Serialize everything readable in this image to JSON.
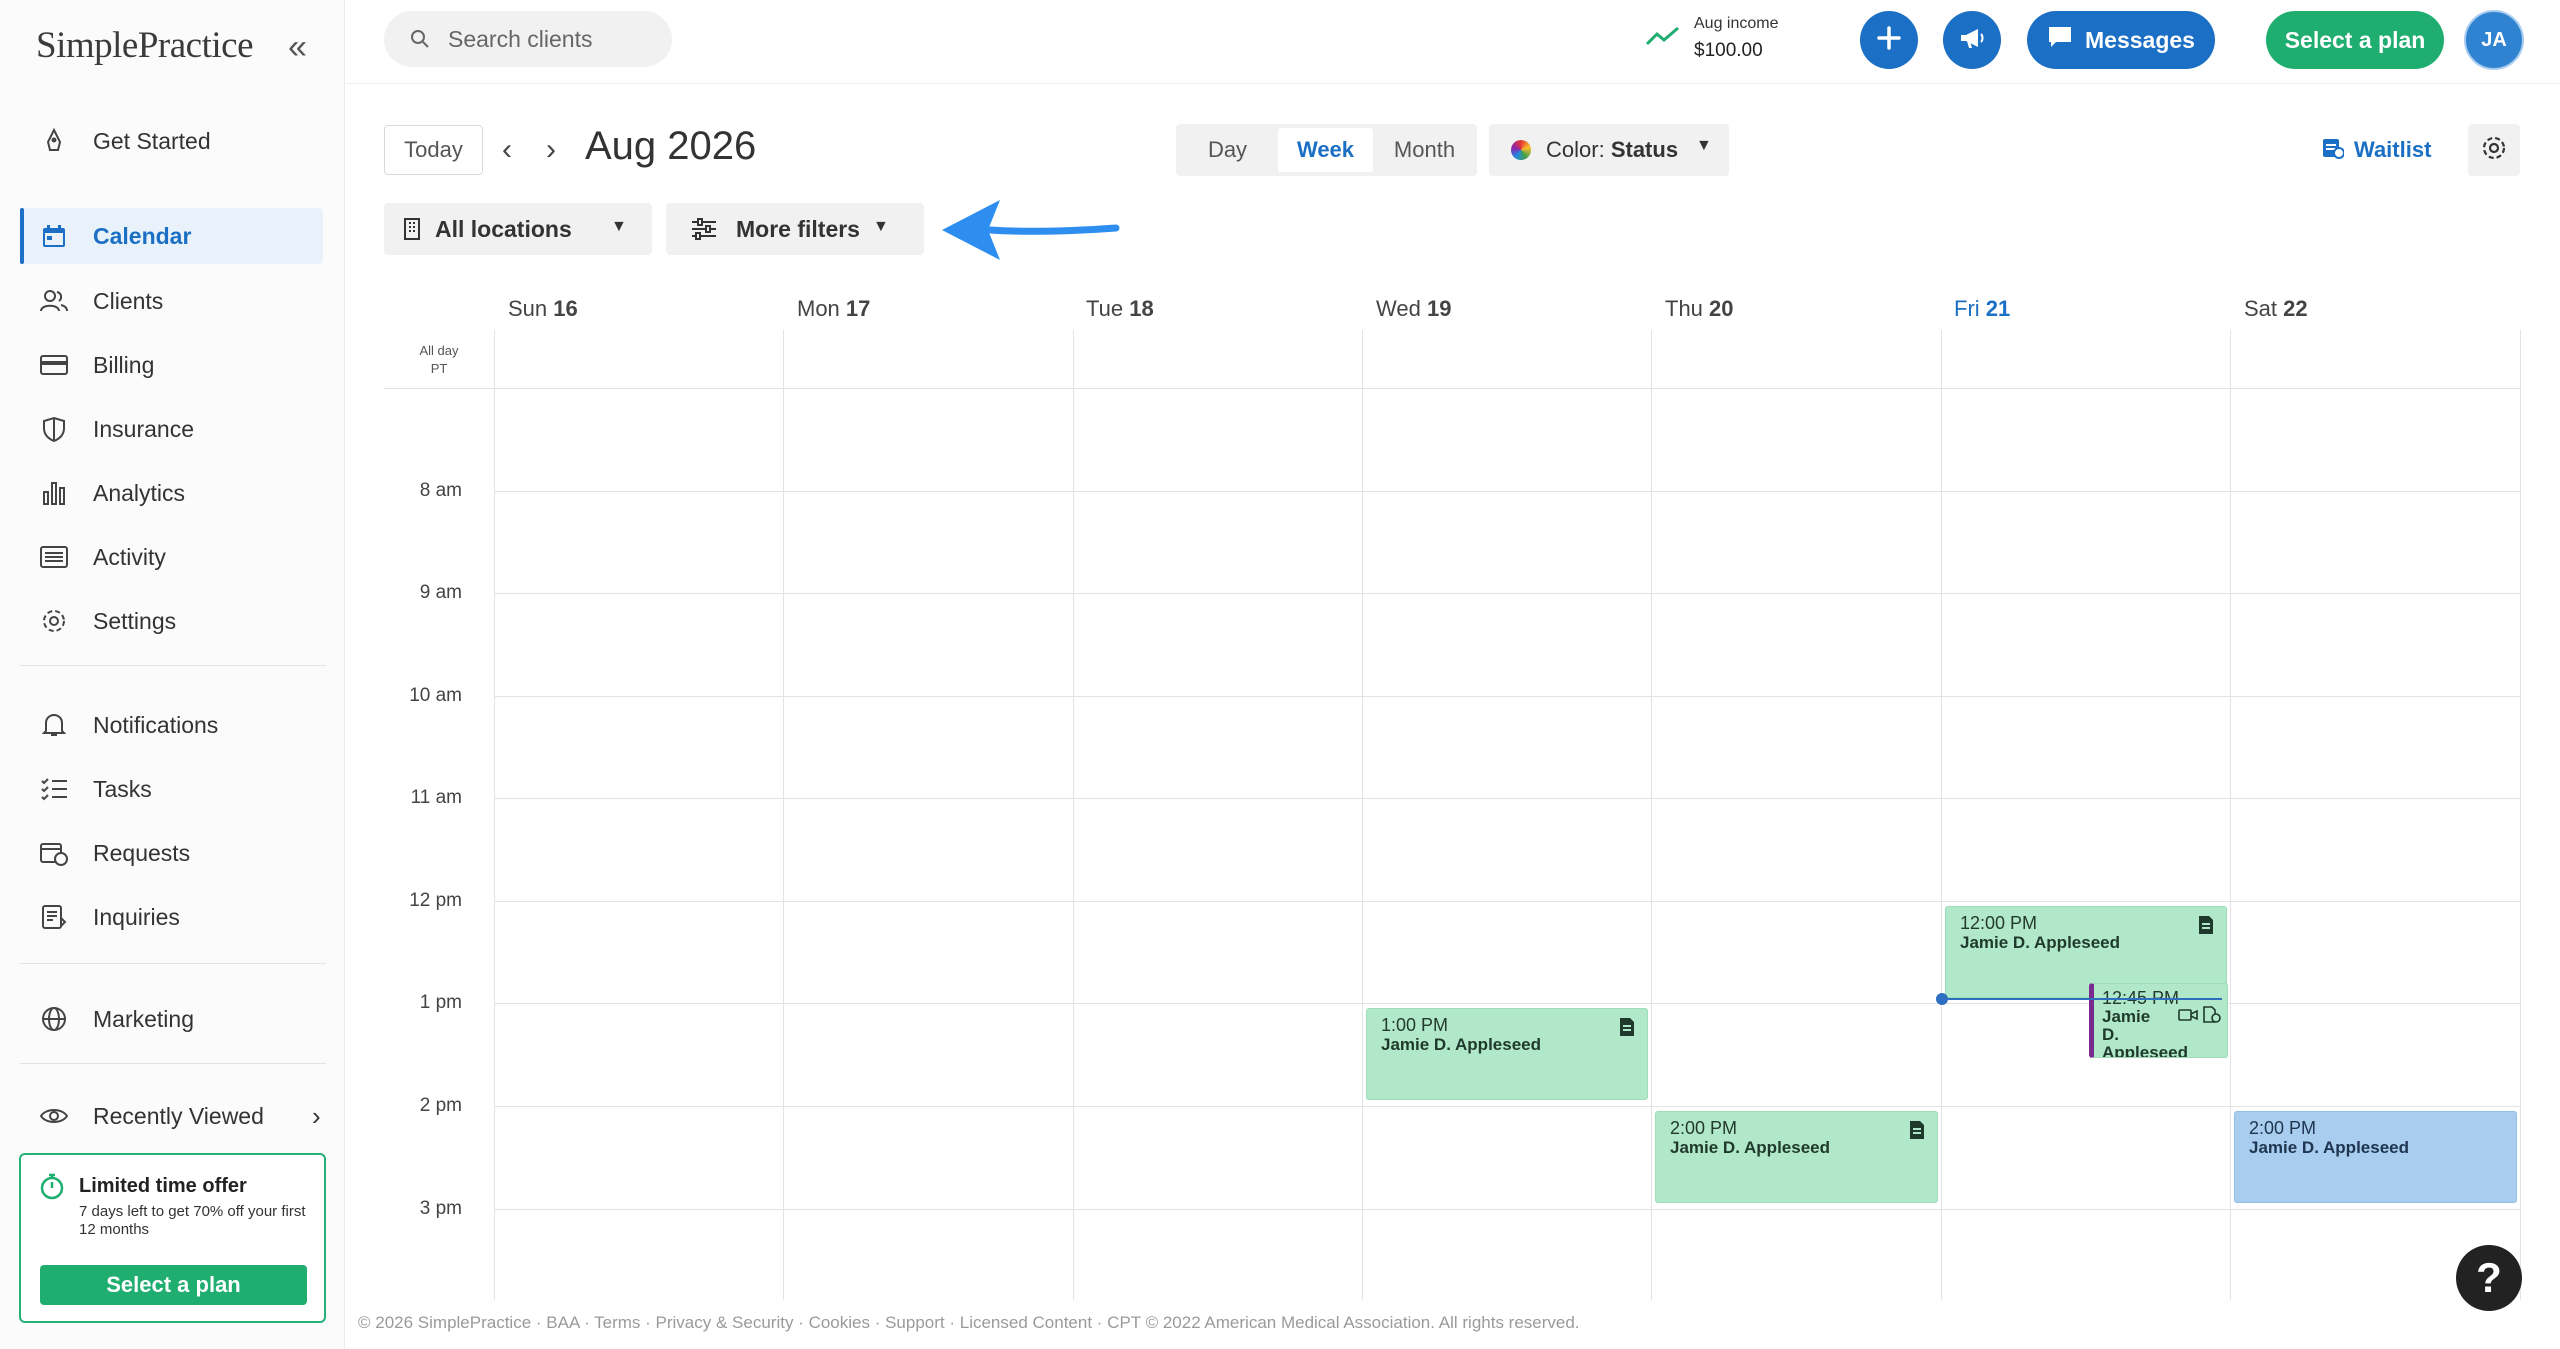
{
  "brand": {
    "logo_text": "SimplePractice"
  },
  "sidebar": {
    "collapse_icon": "double-chevron-left-icon",
    "items": [
      {
        "label": "Get Started",
        "icon": "rocket-icon"
      },
      {
        "label": "Calendar",
        "icon": "calendar-icon",
        "active": true
      },
      {
        "label": "Clients",
        "icon": "clients-icon"
      },
      {
        "label": "Billing",
        "icon": "credit-card-icon"
      },
      {
        "label": "Insurance",
        "icon": "shield-icon"
      },
      {
        "label": "Analytics",
        "icon": "bar-chart-icon"
      },
      {
        "label": "Activity",
        "icon": "list-icon"
      },
      {
        "label": "Settings",
        "icon": "gear-icon"
      },
      {
        "label": "Notifications",
        "icon": "bell-icon"
      },
      {
        "label": "Tasks",
        "icon": "tasks-icon"
      },
      {
        "label": "Requests",
        "icon": "calendar-request-icon"
      },
      {
        "label": "Inquiries",
        "icon": "inquiry-icon"
      },
      {
        "label": "Marketing",
        "icon": "globe-icon"
      },
      {
        "label": "Recently Viewed",
        "icon": "eye-icon"
      }
    ]
  },
  "offer": {
    "title": "Limited time offer",
    "text": "7 days left to get 70% off your first 12 months",
    "button": "Select a plan"
  },
  "topbar": {
    "search_placeholder": "Search clients",
    "income_label": "Aug income",
    "income_value": "$100.00",
    "messages_label": "Messages",
    "select_plan_label": "Select a plan",
    "avatar_initials": "JA"
  },
  "toolbar": {
    "today_label": "Today",
    "period_title": "Aug 2026",
    "views": [
      "Day",
      "Week",
      "Month"
    ],
    "active_view": "Week",
    "color_prefix": "Color:",
    "color_value": "Status",
    "waitlist_label": "Waitlist",
    "locations_label": "All locations",
    "more_filters_label": "More filters"
  },
  "calendar": {
    "days": [
      {
        "dow": "Sun",
        "date": "16"
      },
      {
        "dow": "Mon",
        "date": "17"
      },
      {
        "dow": "Tue",
        "date": "18"
      },
      {
        "dow": "Wed",
        "date": "19"
      },
      {
        "dow": "Thu",
        "date": "20"
      },
      {
        "dow": "Fri",
        "date": "21",
        "today": true
      },
      {
        "dow": "Sat",
        "date": "22"
      }
    ],
    "all_day_label": "All day",
    "timezone_label": "PT",
    "hours": [
      "8 am",
      "9 am",
      "10 am",
      "11 am",
      "12 pm",
      "1 pm",
      "2 pm",
      "3 pm"
    ],
    "appointments": [
      {
        "time": "1:00 PM",
        "client": "Jamie D. Appleseed",
        "day": "Wed"
      },
      {
        "time": "2:00 PM",
        "client": "Jamie D. Appleseed",
        "day": "Thu"
      },
      {
        "time": "12:00 PM",
        "client": "Jamie D. Appleseed",
        "day": "Fri"
      },
      {
        "time": "12:45 PM",
        "client": "Jamie D. Appleseed",
        "day": "Fri"
      },
      {
        "time": "2:00 PM",
        "client": "Jamie D. Appleseed",
        "day": "Sat"
      }
    ],
    "colors": {
      "appointment_green": "#b1e8c9",
      "appointment_blue": "#a9cdee",
      "accent": "#1b6fc4"
    }
  },
  "footer": {
    "text": "© 2026 SimplePractice · BAA · Terms · Privacy & Security · Cookies · Support · Licensed Content · CPT © 2022 American Medical Association. All rights reserved."
  },
  "help_label": "?"
}
